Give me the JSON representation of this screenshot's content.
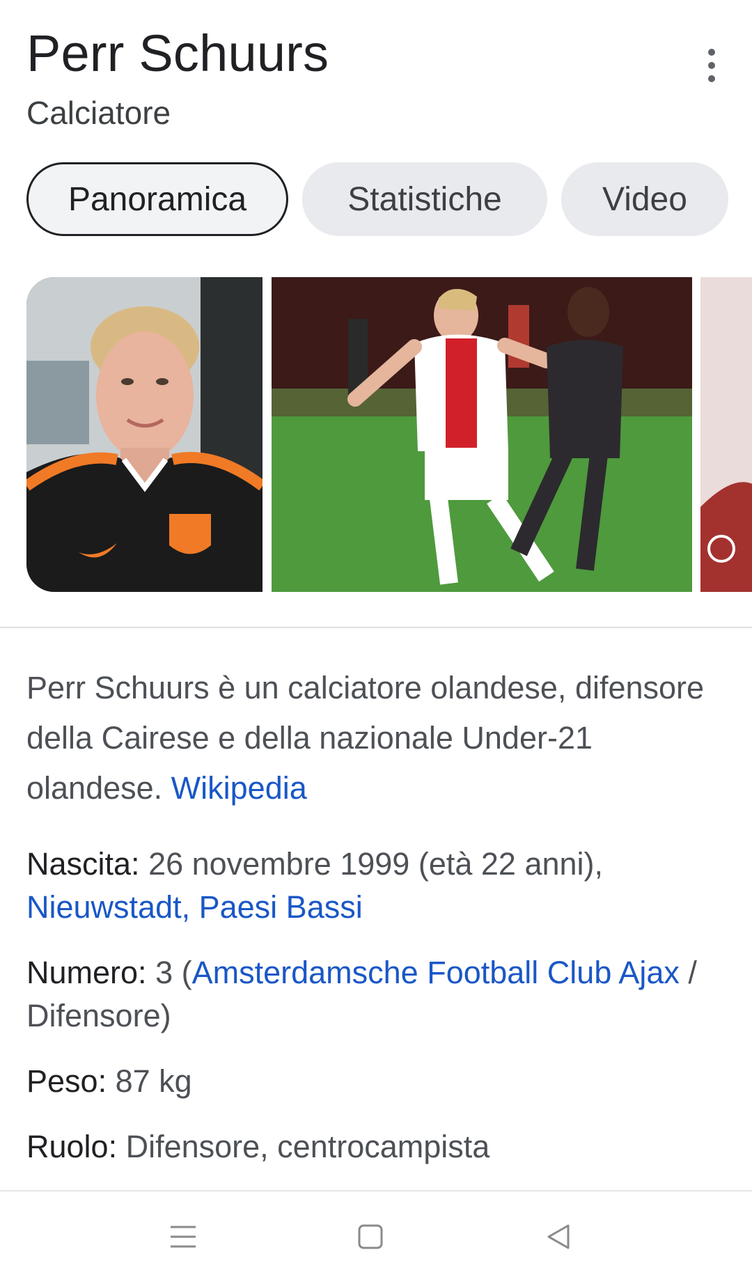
{
  "header": {
    "title": "Perr Schuurs",
    "subtitle": "Calciatore"
  },
  "tabs": [
    {
      "label": "Panoramica",
      "active": true
    },
    {
      "label": "Statistiche",
      "active": false
    },
    {
      "label": "Video",
      "active": false
    }
  ],
  "description": {
    "text": "Perr Schuurs è un calciatore olandese, difensore della Cairese e della nazionale Under-21 olandese. ",
    "source": "Wikipedia"
  },
  "facts": {
    "birth": {
      "label": "Nascita:",
      "value": " 26 novembre 1999 (età 22 anni), ",
      "place": "Nieuwstadt, Paesi Bassi"
    },
    "number": {
      "label": "Numero:",
      "value": " 3 (",
      "club": "Amsterdamsche Football Club Ajax",
      "role": " / Difensore)"
    },
    "weight": {
      "label": "Peso:",
      "value": " 87 kg"
    },
    "position": {
      "label": "Ruolo:",
      "value": " Difensore, centrocampista"
    }
  },
  "colors": {
    "link": "#1a57c6",
    "title": "#202124",
    "body_text": "#4d5156",
    "chip_bg": "#e8eaed"
  },
  "icons": {
    "more": "more-vert-icon",
    "nav_recents": "menu-icon",
    "nav_home": "square-icon",
    "nav_back": "triangle-back-icon"
  }
}
